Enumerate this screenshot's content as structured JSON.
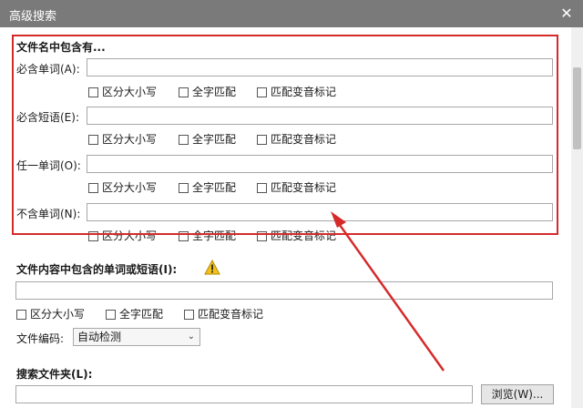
{
  "window": {
    "title": "高级搜索",
    "close_icon": "close-icon",
    "close_glyph": "✕"
  },
  "filename_section": {
    "heading": "文件名中包含有...",
    "rows": [
      {
        "label": "必含单词(A):",
        "value": ""
      },
      {
        "label": "必含短语(E):",
        "value": ""
      },
      {
        "label": "任一单词(O):",
        "value": ""
      },
      {
        "label": "不含单词(N):",
        "value": ""
      }
    ]
  },
  "checkbox_labels": {
    "match_case": "区分大小写",
    "whole_word": "全字匹配",
    "match_diacritics": "匹配变音标记"
  },
  "content_section": {
    "heading": "文件内容中包含的单词或短语(I):",
    "warning_icon": "warning-icon",
    "value": ""
  },
  "encoding": {
    "label": "文件编码:",
    "selected": "自动检测"
  },
  "folder_section": {
    "heading": "搜索文件夹(L):",
    "value": "",
    "browse_label": "浏览(W)..."
  },
  "colors": {
    "title_bar": "#7a7a7a",
    "annotation_red": "#d62a2a",
    "warning_yellow": "#f2c21b"
  }
}
